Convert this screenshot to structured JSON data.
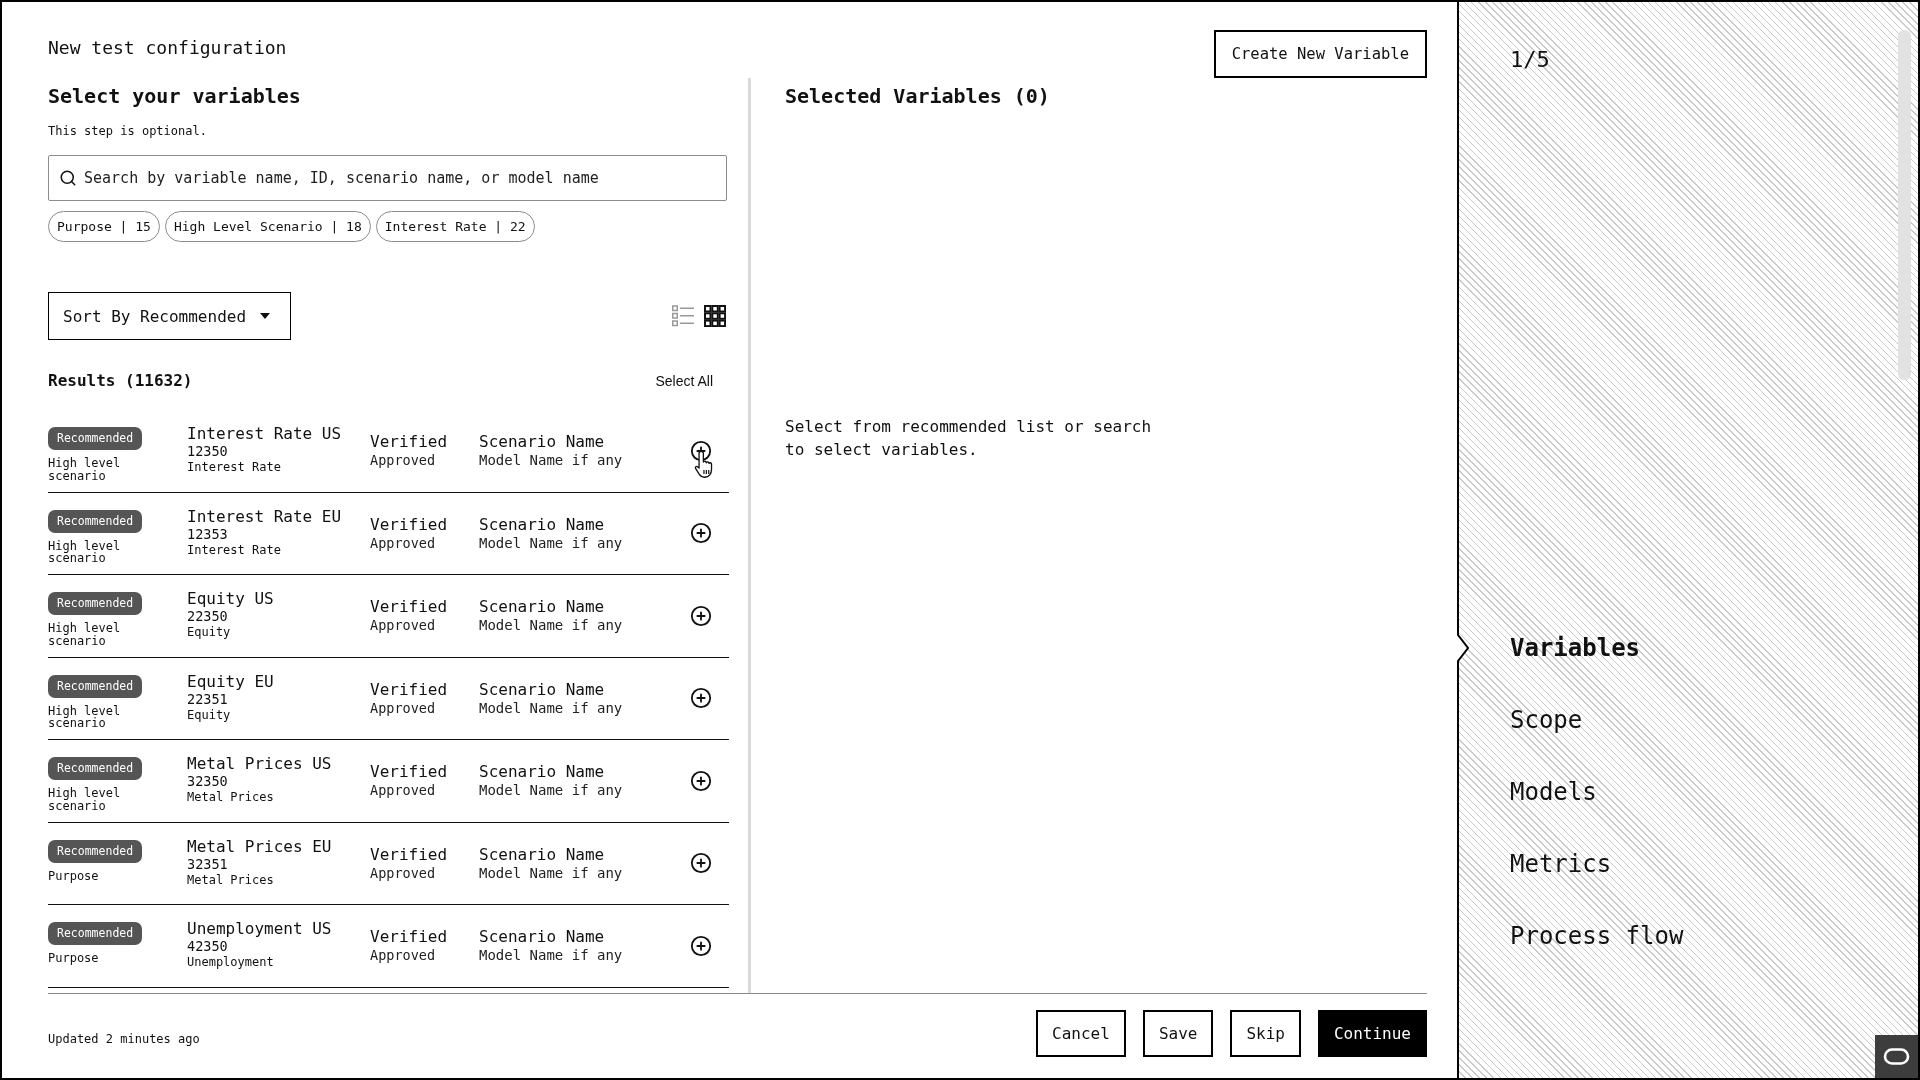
{
  "header": {
    "title": "New test configuration",
    "create_button": "Create New Variable"
  },
  "variables_panel": {
    "heading": "Select your variables",
    "hint": "This step is optional.",
    "search": {
      "placeholder": "Search by variable name, ID, scenario name, or model name"
    },
    "filters": [
      "Purpose | 15",
      "High Level Scenario | 18",
      "Interest Rate | 22"
    ],
    "sort": {
      "label": "Sort By Recommended"
    },
    "view_modes": [
      {
        "kind": "list",
        "selected": false
      },
      {
        "kind": "grid",
        "selected": true
      }
    ],
    "results_title": "Results (11632)",
    "select_all": "Select All",
    "rows": [
      {
        "badge": "Recommended",
        "scope": "High level scenario",
        "name": "Interest Rate US",
        "id": "12350",
        "category": "Interest Rate",
        "status": "Verified",
        "approval": "Approved",
        "scenario": "Scenario Name",
        "model": "Model Name if any",
        "hovered": true
      },
      {
        "badge": "Recommended",
        "scope": "High level scenario",
        "name": "Interest Rate EU",
        "id": "12353",
        "category": "Interest Rate",
        "status": "Verified",
        "approval": "Approved",
        "scenario": "Scenario Name",
        "model": "Model Name if any",
        "hovered": false
      },
      {
        "badge": "Recommended",
        "scope": "High level scenario",
        "name": "Equity US",
        "id": "22350",
        "category": "Equity",
        "status": "Verified",
        "approval": "Approved",
        "scenario": "Scenario Name",
        "model": "Model Name if any",
        "hovered": false
      },
      {
        "badge": "Recommended",
        "scope": "High level scenario",
        "name": "Equity EU",
        "id": "22351",
        "category": "Equity",
        "status": "Verified",
        "approval": "Approved",
        "scenario": "Scenario Name",
        "model": "Model Name if any",
        "hovered": false
      },
      {
        "badge": "Recommended",
        "scope": "High level scenario",
        "name": "Metal Prices US",
        "id": "32350",
        "category": "Metal Prices",
        "status": "Verified",
        "approval": "Approved",
        "scenario": "Scenario Name",
        "model": "Model Name if any",
        "hovered": false
      },
      {
        "badge": "Recommended",
        "scope": "Purpose",
        "name": "Metal Prices EU",
        "id": "32351",
        "category": "Metal Prices",
        "status": "Verified",
        "approval": "Approved",
        "scenario": "Scenario Name",
        "model": "Model Name if any",
        "hovered": false
      },
      {
        "badge": "Recommended",
        "scope": "Purpose",
        "name": "Unemployment US",
        "id": "42350",
        "category": "Unemployment",
        "status": "Verified",
        "approval": "Approved",
        "scenario": "Scenario Name",
        "model": "Model Name if any",
        "hovered": false
      }
    ]
  },
  "selected_panel": {
    "heading": "Selected Variables (0)",
    "empty_message": "Select from recommended list or search to select variables."
  },
  "footer": {
    "updated": "Updated 2 minutes ago",
    "buttons": [
      {
        "label": "Cancel",
        "kind": "secondary"
      },
      {
        "label": "Save",
        "kind": "secondary"
      },
      {
        "label": "Skip",
        "kind": "secondary"
      },
      {
        "label": "Continue",
        "kind": "primary"
      }
    ]
  },
  "sidebar": {
    "progress": "1/5",
    "steps": [
      {
        "label": "Variables",
        "selected": true
      },
      {
        "label": "Scope",
        "selected": false
      },
      {
        "label": "Models",
        "selected": false
      },
      {
        "label": "Metrics",
        "selected": false
      },
      {
        "label": "Process flow",
        "selected": false
      }
    ]
  }
}
